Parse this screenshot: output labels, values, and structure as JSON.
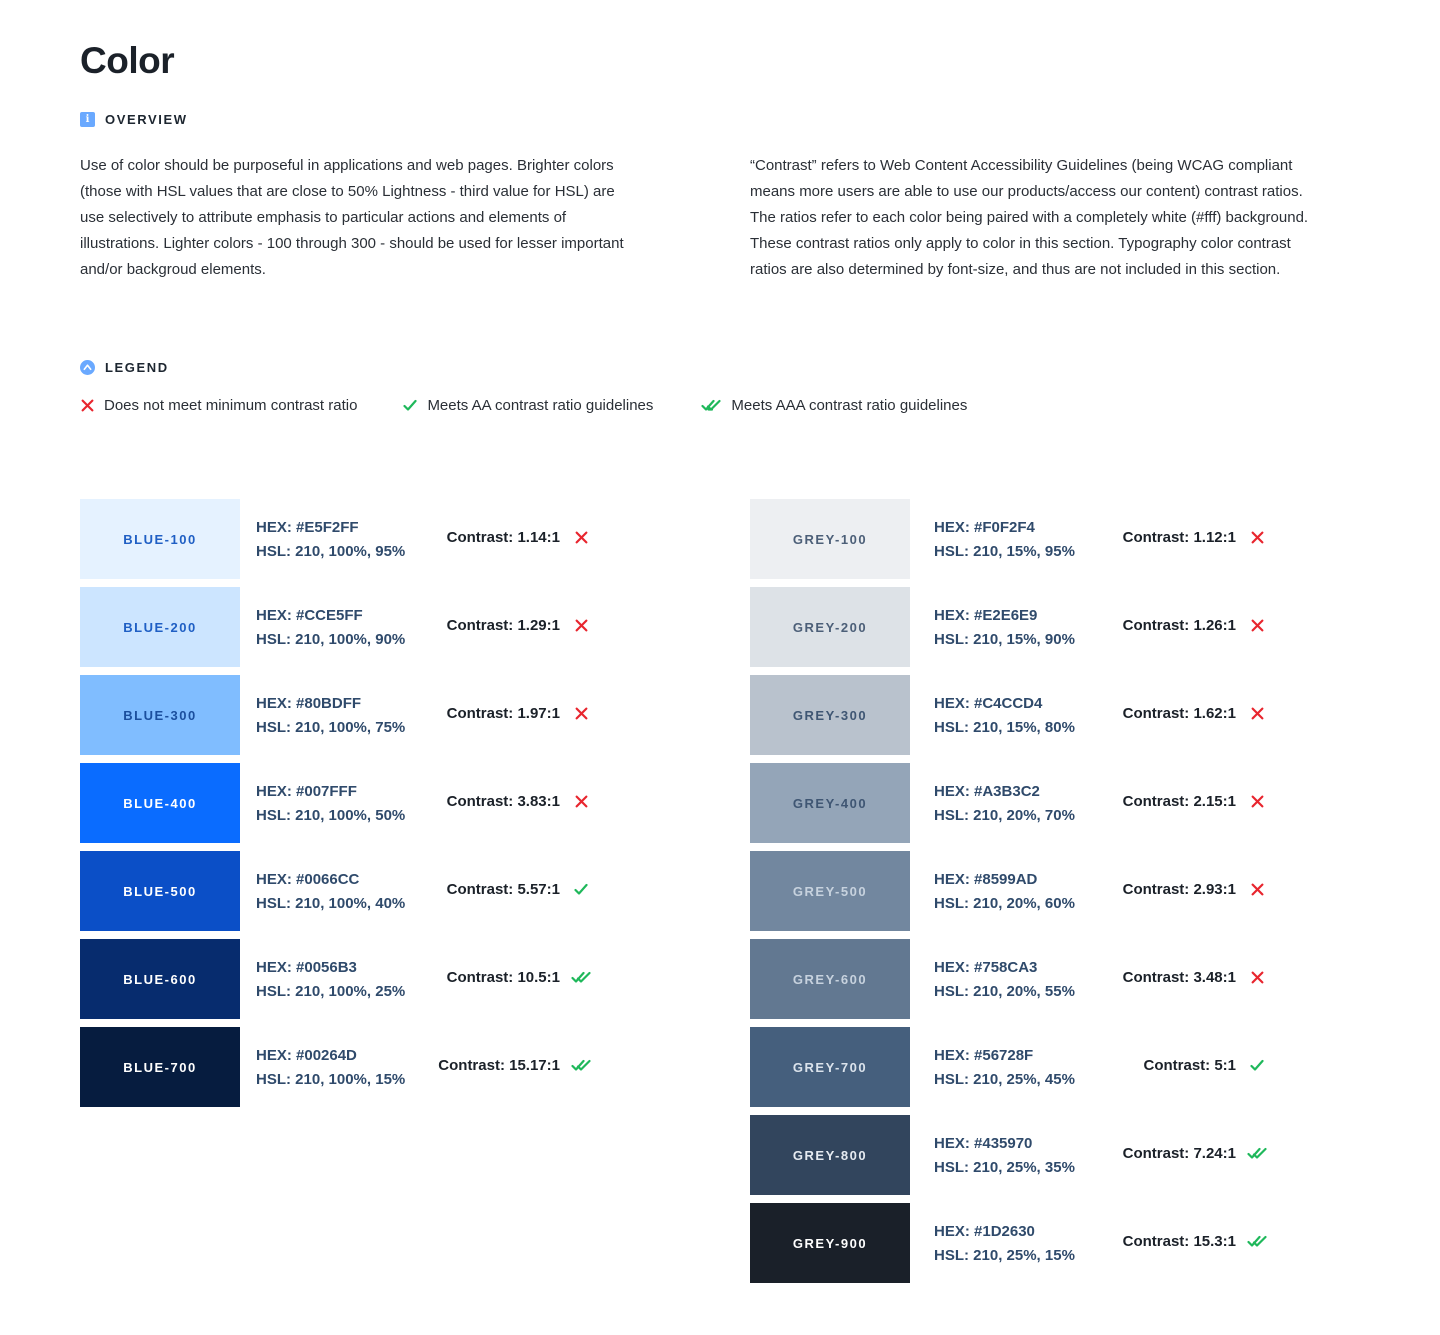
{
  "title": "Color",
  "overview": {
    "heading": "OVERVIEW",
    "left_text": "Use of color should be purposeful in applications and web pages. Brighter colors (those with HSL values that are close to 50% Lightness - third value for HSL) are use selectively to attribute emphasis to particular actions and elements of illustrations. Lighter colors - 100 through 300 - should be used for lesser important and/or backgroud elements.",
    "right_text": "“Contrast” refers to Web Content Accessibility Guidelines (being WCAG compliant means more users are able to use our products/access our content) contrast ratios. The ratios refer to each color being paired with a completely white (#fff) background. These contrast ratios only apply to color in this section. Typography color contrast ratios are also determined by font-size, and thus are not included in this section."
  },
  "legend": {
    "heading": "LEGEND",
    "fail": "Does not meet minimum contrast ratio",
    "aa": "Meets AA contrast ratio guidelines",
    "aaa": "Meets AAA contrast ratio guidelines"
  },
  "colors": {
    "fail_icon": "#e8252e",
    "pass_icon": "#1fb85b",
    "accent": "#6aa9ff"
  },
  "blue": [
    {
      "name": "BLUE-100",
      "hex": "HEX: #E5F2FF",
      "hsl": "HSL: 210, 100%, 95%",
      "contrast": "Contrast: 1.14:1",
      "status": "fail",
      "bg": "#E5F2FF",
      "fg": "#1f5fc4"
    },
    {
      "name": "BLUE-200",
      "hex": "HEX: #CCE5FF",
      "hsl": "HSL: 210, 100%, 90%",
      "contrast": "Contrast: 1.29:1",
      "status": "fail",
      "bg": "#CCE5FF",
      "fg": "#1f5fc4"
    },
    {
      "name": "BLUE-300",
      "hex": "HEX: #80BDFF",
      "hsl": "HSL: 210, 100%, 75%",
      "contrast": "Contrast: 1.97:1",
      "status": "fail",
      "bg": "#80BDFF",
      "fg": "#1b4f9e"
    },
    {
      "name": "BLUE-400",
      "hex": "HEX: #007FFF",
      "hsl": "HSL: 210, 100%, 50%",
      "contrast": "Contrast: 3.83:1",
      "status": "fail",
      "bg": "#0a6cff",
      "fg": "#ffffff"
    },
    {
      "name": "BLUE-500",
      "hex": "HEX: #0066CC",
      "hsl": "HSL: 210, 100%, 40%",
      "contrast": "Contrast: 5.57:1",
      "status": "aa",
      "bg": "#0b4fc7",
      "fg": "#ffffff"
    },
    {
      "name": "BLUE-600",
      "hex": "HEX: #0056B3",
      "hsl": "HSL: 210, 100%, 25%",
      "contrast": "Contrast: 10.5:1",
      "status": "aaa",
      "bg": "#072c6e",
      "fg": "#ffffff"
    },
    {
      "name": "BLUE-700",
      "hex": "HEX: #00264D",
      "hsl": "HSL: 210, 100%, 15%",
      "contrast": "Contrast: 15.17:1",
      "status": "aaa",
      "bg": "#061c3f",
      "fg": "#ffffff"
    }
  ],
  "grey": [
    {
      "name": "GREY-100",
      "hex": "HEX: #F0F2F4",
      "hsl": "HSL: 210, 15%, 95%",
      "contrast": "Contrast: 1.12:1",
      "status": "fail",
      "bg": "#EDEFF2",
      "fg": "#4c5f78"
    },
    {
      "name": "GREY-200",
      "hex": "HEX: #E2E6E9",
      "hsl": "HSL: 210, 15%, 90%",
      "contrast": "Contrast: 1.26:1",
      "status": "fail",
      "bg": "#DDE2E7",
      "fg": "#4c5f78"
    },
    {
      "name": "GREY-300",
      "hex": "HEX: #C4CCD4",
      "hsl": "HSL: 210, 15%, 80%",
      "contrast": "Contrast: 1.62:1",
      "status": "fail",
      "bg": "#B9C2CD",
      "fg": "#3f5673"
    },
    {
      "name": "GREY-400",
      "hex": "HEX: #A3B3C2",
      "hsl": "HSL: 210, 20%, 70%",
      "contrast": "Contrast: 2.15:1",
      "status": "fail",
      "bg": "#94A5B8",
      "fg": "#3f5673"
    },
    {
      "name": "GREY-500",
      "hex": "HEX: #8599AD",
      "hsl": "HSL: 210, 20%, 60%",
      "contrast": "Contrast: 2.93:1",
      "status": "fail",
      "bg": "#72879F",
      "fg": "#c7d2de"
    },
    {
      "name": "GREY-600",
      "hex": "HEX: #758CA3",
      "hsl": "HSL: 210, 20%, 55%",
      "contrast": "Contrast: 3.48:1",
      "status": "fail",
      "bg": "#627891",
      "fg": "#c7d2de"
    },
    {
      "name": "GREY-700",
      "hex": "HEX: #56728F",
      "hsl": "HSL: 210, 25%, 45%",
      "contrast": "Contrast: 5:1",
      "status": "aa",
      "bg": "#455F7D",
      "fg": "#dbe3ec"
    },
    {
      "name": "GREY-800",
      "hex": "HEX: #435970",
      "hsl": "HSL: 210, 25%, 35%",
      "contrast": "Contrast: 7.24:1",
      "status": "aaa",
      "bg": "#32455D",
      "fg": "#e6ebf1"
    },
    {
      "name": "GREY-900",
      "hex": "HEX: #1D2630",
      "hsl": "HSL: 210, 25%, 15%",
      "contrast": "Contrast: 15.3:1",
      "status": "aaa",
      "bg": "#1A2029",
      "fg": "#ffffff"
    }
  ]
}
